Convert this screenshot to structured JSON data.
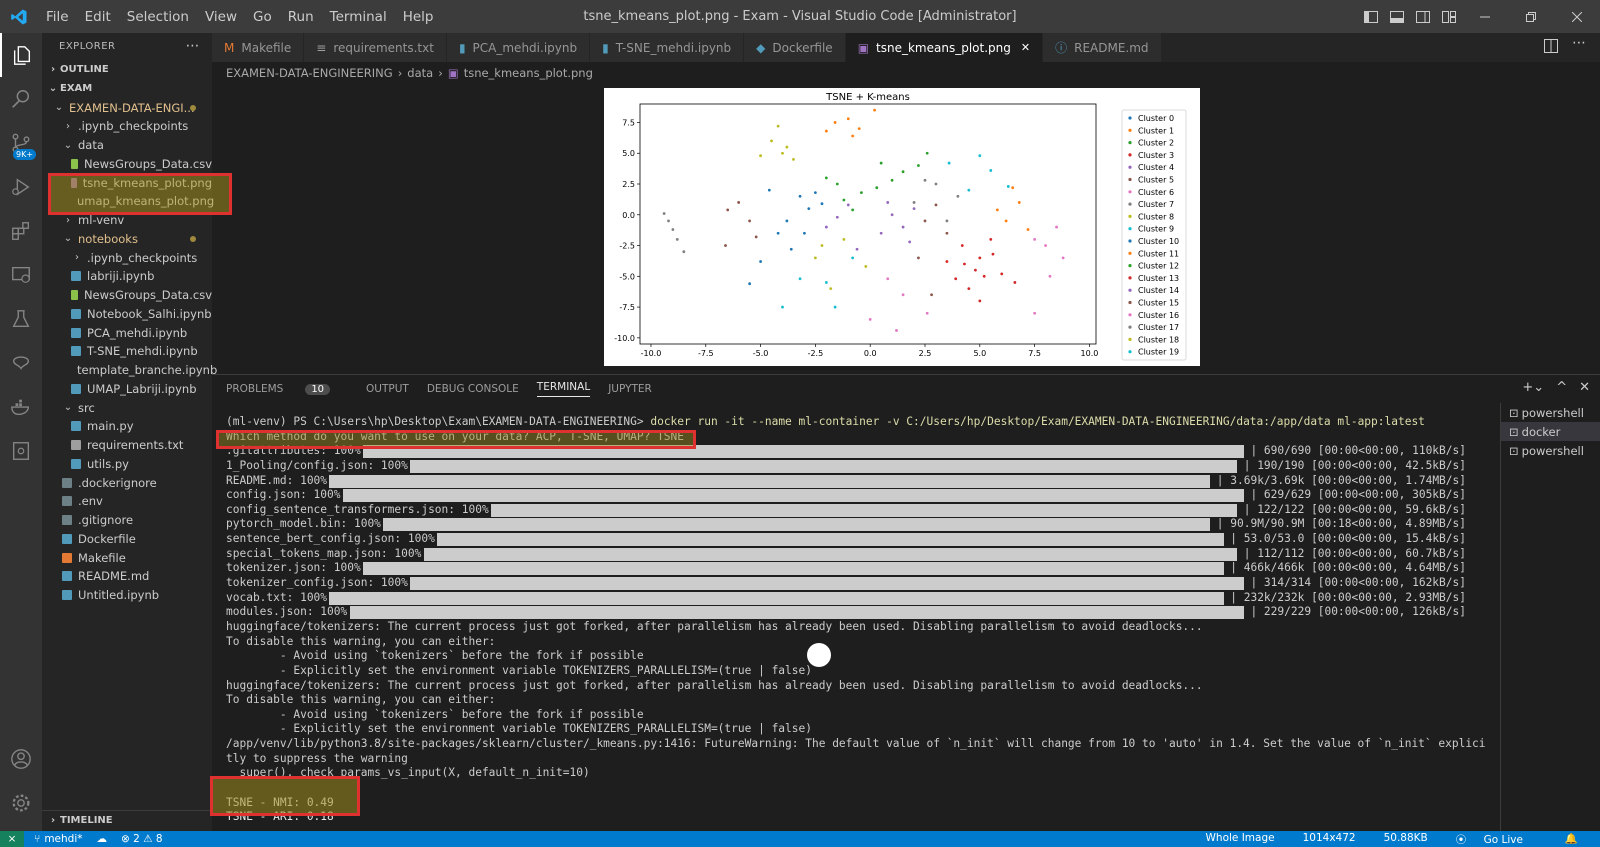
{
  "titlebar": {
    "menus": [
      "File",
      "Edit",
      "Selection",
      "View",
      "Go",
      "Run",
      "Terminal",
      "Help"
    ],
    "title": "tsne_kmeans_plot.png - Exam - Visual Studio Code [Administrator]"
  },
  "activity": {
    "scm_badge": "9K+"
  },
  "sidebar": {
    "header": "EXPLORER",
    "outline": "OUTLINE",
    "workspace": "EXAM",
    "timeline": "TIMELINE",
    "tree": [
      {
        "label": "EXAMEN-DATA-ENGI...",
        "indent": 1,
        "chev": "⌄",
        "color": "#e2c08d",
        "dot": true
      },
      {
        "label": ".ipynb_checkpoints",
        "indent": 2,
        "chev": "›"
      },
      {
        "label": "data",
        "indent": 2,
        "chev": "⌄"
      },
      {
        "label": "NewsGroups_Data.csv",
        "indent": 3,
        "icon": "#8bc34a"
      },
      {
        "label": "tsne_kmeans_plot.png",
        "indent": 3,
        "icon": "#a074c4",
        "color": "#e2e2e2"
      },
      {
        "label": "umap_kmeans_plot.png",
        "indent": 3,
        "icon": "#a074c4",
        "color": "#e2e2e2"
      },
      {
        "label": "ml-venv",
        "indent": 2,
        "chev": "›"
      },
      {
        "label": "notebooks",
        "indent": 2,
        "chev": "⌄",
        "color": "#e2c08d",
        "dot": true
      },
      {
        "label": ".ipynb_checkpoints",
        "indent": 3,
        "chev": "›"
      },
      {
        "label": "labriji.ipynb",
        "indent": 3,
        "icon": "#519aba"
      },
      {
        "label": "NewsGroups_Data.csv",
        "indent": 3,
        "icon": "#8bc34a"
      },
      {
        "label": "Notebook_Salhi.ipynb",
        "indent": 3,
        "icon": "#519aba"
      },
      {
        "label": "PCA_mehdi.ipynb",
        "indent": 3,
        "icon": "#519aba"
      },
      {
        "label": "T-SNE_mehdi.ipynb",
        "indent": 3,
        "icon": "#519aba"
      },
      {
        "label": "template_branche.ipynb",
        "indent": 3,
        "icon": "#519aba"
      },
      {
        "label": "UMAP_Labriji.ipynb",
        "indent": 3,
        "icon": "#519aba"
      },
      {
        "label": "src",
        "indent": 2,
        "chev": "⌄"
      },
      {
        "label": "main.py",
        "indent": 3,
        "icon": "#519aba"
      },
      {
        "label": "requirements.txt",
        "indent": 3,
        "icon": "#9e9e9e"
      },
      {
        "label": "utils.py",
        "indent": 3,
        "icon": "#519aba"
      },
      {
        "label": ".dockerignore",
        "indent": 2,
        "icon": "#6d8086"
      },
      {
        "label": ".env",
        "indent": 2,
        "icon": "#6d8086"
      },
      {
        "label": ".gitignore",
        "indent": 2,
        "icon": "#6d8086"
      },
      {
        "label": "Dockerfile",
        "indent": 2,
        "icon": "#519aba"
      },
      {
        "label": "Makefile",
        "indent": 2,
        "icon": "#e37933"
      },
      {
        "label": "README.md",
        "indent": 2,
        "icon": "#519aba"
      },
      {
        "label": "Untitled.ipynb",
        "indent": 2,
        "icon": "#519aba"
      }
    ]
  },
  "tabs": [
    {
      "label": "Makefile",
      "icon": "M",
      "color": "#e37933",
      "active": false
    },
    {
      "label": "requirements.txt",
      "icon": "≡",
      "color": "#9e9e9e",
      "active": false
    },
    {
      "label": "PCA_mehdi.ipynb",
      "icon": "▮",
      "color": "#519aba",
      "active": false
    },
    {
      "label": "T-SNE_mehdi.ipynb",
      "icon": "▮",
      "color": "#519aba",
      "active": false
    },
    {
      "label": "Dockerfile",
      "icon": "◆",
      "color": "#519aba",
      "active": false
    },
    {
      "label": "tsne_kmeans_plot.png",
      "icon": "▣",
      "color": "#a074c4",
      "active": true
    },
    {
      "label": "README.md",
      "icon": "ⓘ",
      "color": "#519aba",
      "active": false
    }
  ],
  "breadcrumb": [
    "EXAMEN-DATA-ENGINEERING",
    "data",
    "tsne_kmeans_plot.png"
  ],
  "chart_data": {
    "type": "scatter",
    "title": "TSNE + K-means",
    "xlim": [
      -10.5,
      10.3
    ],
    "ylim": [
      -10.5,
      9.0
    ],
    "xticks": [
      -10.0,
      -7.5,
      -5.0,
      -2.5,
      0.0,
      2.5,
      5.0,
      7.5,
      10.0
    ],
    "yticks": [
      -10.0,
      -7.5,
      -5.0,
      -2.5,
      0.0,
      2.5,
      5.0,
      7.5
    ],
    "legend_position": "right",
    "series": [
      {
        "name": "Cluster 0",
        "color": "#1f77b4",
        "points": [
          [
            -3.2,
            1.5
          ],
          [
            -2.8,
            0.5
          ],
          [
            -3.8,
            -0.5
          ],
          [
            -2.2,
            0.9
          ],
          [
            -3.0,
            -1.5
          ],
          [
            -2.5,
            1.8
          ]
        ]
      },
      {
        "name": "Cluster 1",
        "color": "#ff7f0e",
        "points": [
          [
            -1.6,
            7.5
          ],
          [
            -1.0,
            7.8
          ],
          [
            -0.5,
            7.0
          ],
          [
            -2.0,
            6.8
          ],
          [
            0.2,
            8.5
          ],
          [
            -0.8,
            6.4
          ]
        ]
      },
      {
        "name": "Cluster 2",
        "color": "#2ca02c",
        "points": [
          [
            -1.5,
            2.5
          ],
          [
            -1.2,
            1.2
          ],
          [
            -0.4,
            1.8
          ],
          [
            -2.0,
            3.0
          ],
          [
            -0.8,
            0.4
          ],
          [
            0.3,
            2.2
          ]
        ]
      },
      {
        "name": "Cluster 3",
        "color": "#d62728",
        "points": [
          [
            4.2,
            -2.5
          ],
          [
            5.0,
            -3.5
          ],
          [
            4.8,
            -4.5
          ],
          [
            3.9,
            -5.2
          ],
          [
            5.5,
            -2.0
          ],
          [
            4.5,
            -6.0
          ],
          [
            3.5,
            -3.8
          ]
        ]
      },
      {
        "name": "Cluster 4",
        "color": "#9467bd",
        "points": [
          [
            1.0,
            0.0
          ],
          [
            1.5,
            -1.0
          ],
          [
            2.0,
            0.5
          ],
          [
            0.8,
            1.0
          ],
          [
            1.8,
            -2.2
          ]
        ]
      },
      {
        "name": "Cluster 5",
        "color": "#8c564b",
        "points": [
          [
            -6.5,
            0.4
          ],
          [
            -5.5,
            -0.5
          ],
          [
            -6.0,
            1.0
          ],
          [
            -5.2,
            -1.8
          ],
          [
            -6.6,
            -2.5
          ]
        ]
      },
      {
        "name": "Cluster 6",
        "color": "#e377c2",
        "points": [
          [
            7.5,
            -2.0
          ],
          [
            8.0,
            -2.5
          ],
          [
            8.5,
            -1.0
          ],
          [
            8.8,
            -3.5
          ],
          [
            8.2,
            -5.0
          ],
          [
            7.5,
            -8.0
          ]
        ]
      },
      {
        "name": "Cluster 7",
        "color": "#7f7f7f",
        "points": [
          [
            -9.2,
            -0.5
          ],
          [
            -9.0,
            -1.2
          ],
          [
            -8.8,
            -2.0
          ],
          [
            -9.4,
            0.1
          ],
          [
            -8.5,
            -3.0
          ]
        ]
      },
      {
        "name": "Cluster 8",
        "color": "#bcbd22",
        "points": [
          [
            -4.0,
            5.0
          ],
          [
            -4.5,
            6.0
          ],
          [
            -3.5,
            4.5
          ],
          [
            -5.0,
            4.8
          ],
          [
            -4.2,
            7.2
          ],
          [
            -3.8,
            5.5
          ]
        ]
      },
      {
        "name": "Cluster 9",
        "color": "#17becf",
        "points": [
          [
            -3.2,
            -5.2
          ],
          [
            -2.0,
            -5.5
          ],
          [
            -1.6,
            -7.5
          ],
          [
            -4.0,
            -7.5
          ],
          [
            -0.8,
            -3.5
          ]
        ]
      },
      {
        "name": "Cluster 10",
        "color": "#1f77b4",
        "points": [
          [
            -4.2,
            -1.5
          ],
          [
            -5.0,
            -3.8
          ],
          [
            -4.6,
            2.0
          ],
          [
            -3.6,
            -2.8
          ],
          [
            -5.5,
            -5.6
          ]
        ]
      },
      {
        "name": "Cluster 11",
        "color": "#ff7f0e",
        "points": [
          [
            6.2,
            -0.5
          ],
          [
            6.8,
            1.0
          ],
          [
            5.8,
            0.4
          ],
          [
            7.2,
            -1.2
          ],
          [
            6.5,
            2.2
          ]
        ]
      },
      {
        "name": "Cluster 12",
        "color": "#2ca02c",
        "points": [
          [
            1.5,
            3.5
          ],
          [
            2.2,
            4.0
          ],
          [
            1.0,
            2.8
          ],
          [
            2.6,
            5.0
          ],
          [
            0.5,
            4.2
          ]
        ]
      },
      {
        "name": "Cluster 13",
        "color": "#d62728",
        "points": [
          [
            5.2,
            -5.0
          ],
          [
            6.0,
            -4.8
          ],
          [
            5.6,
            -3.2
          ],
          [
            6.6,
            -5.5
          ],
          [
            5.0,
            -7.0
          ],
          [
            4.3,
            -4.0
          ]
        ]
      },
      {
        "name": "Cluster 14",
        "color": "#9467bd",
        "points": [
          [
            -2.0,
            -1.0
          ],
          [
            -1.5,
            -0.2
          ],
          [
            -0.6,
            -2.8
          ],
          [
            -1.0,
            0.8
          ],
          [
            0.5,
            -1.5
          ]
        ]
      },
      {
        "name": "Cluster 15",
        "color": "#8c564b",
        "points": [
          [
            2.5,
            -0.5
          ],
          [
            3.0,
            0.8
          ],
          [
            2.2,
            -3.5
          ],
          [
            3.5,
            -1.5
          ],
          [
            2.8,
            -6.5
          ]
        ]
      },
      {
        "name": "Cluster 16",
        "color": "#e377c2",
        "points": [
          [
            0.0,
            -8.5
          ],
          [
            1.2,
            -9.4
          ],
          [
            1.5,
            -6.5
          ],
          [
            2.6,
            -8.0
          ],
          [
            0.8,
            -5.2
          ]
        ]
      },
      {
        "name": "Cluster 17",
        "color": "#7f7f7f",
        "points": [
          [
            2.0,
            1.0
          ],
          [
            3.0,
            2.5
          ],
          [
            4.0,
            1.5
          ],
          [
            3.5,
            -0.5
          ],
          [
            2.5,
            2.8
          ]
        ]
      },
      {
        "name": "Cluster 18",
        "color": "#bcbd22",
        "points": [
          [
            -2.5,
            -3.5
          ],
          [
            -1.2,
            -2.0
          ],
          [
            -2.2,
            -2.5
          ],
          [
            -0.2,
            -4.2
          ],
          [
            -1.8,
            -6.0
          ]
        ]
      },
      {
        "name": "Cluster 19",
        "color": "#17becf",
        "points": [
          [
            3.6,
            4.2
          ],
          [
            5.0,
            4.8
          ],
          [
            6.3,
            2.3
          ],
          [
            4.5,
            2.0
          ],
          [
            5.5,
            3.6
          ]
        ]
      }
    ]
  },
  "panel": {
    "tabs": [
      "PROBLEMS",
      "OUTPUT",
      "DEBUG CONSOLE",
      "TERMINAL",
      "JUPYTER"
    ],
    "problems_count": "10",
    "terminals": [
      "powershell",
      "docker",
      "powershell"
    ]
  },
  "terminal": {
    "prompt": "(ml-venv) PS C:\\Users\\hp\\Desktop\\Exam\\EXAMEN-DATA-ENGINEERING> ",
    "command": "docker run -it --name ml-container -v C:/Users/hp/Desktop/Exam/EXAMEN-DATA-ENGINEERING/data:/app/data ml-app:latest",
    "question": "Which method do you want to use on your data? ACP, T-SNE, UMAP? TSNE",
    "downloads": [
      {
        "name": ".gitattributes: 100%",
        "stats": "| 690/690 [00:00<00:00, 110kB/s]"
      },
      {
        "name": "1_Pooling/config.json: 100%",
        "stats": "| 190/190 [00:00<00:00, 42.5kB/s]"
      },
      {
        "name": "README.md: 100%",
        "stats": "| 3.69k/3.69k [00:00<00:00, 1.74MB/s]"
      },
      {
        "name": "config.json: 100%",
        "stats": "| 629/629 [00:00<00:00, 305kB/s]"
      },
      {
        "name": "config_sentence_transformers.json: 100%",
        "stats": "| 122/122 [00:00<00:00, 59.6kB/s]"
      },
      {
        "name": "pytorch_model.bin: 100%",
        "stats": "| 90.9M/90.9M [00:18<00:00, 4.89MB/s]"
      },
      {
        "name": "sentence_bert_config.json: 100%",
        "stats": "| 53.0/53.0 [00:00<00:00, 15.4kB/s]"
      },
      {
        "name": "special_tokens_map.json: 100%",
        "stats": "| 112/112 [00:00<00:00, 60.7kB/s]"
      },
      {
        "name": "tokenizer.json: 100%",
        "stats": "| 466k/466k [00:00<00:00, 4.64MB/s]"
      },
      {
        "name": "tokenizer_config.json: 100%",
        "stats": "| 314/314 [00:00<00:00, 162kB/s]"
      },
      {
        "name": "vocab.txt: 100%",
        "stats": "| 232k/232k [00:00<00:00, 2.93MB/s]"
      },
      {
        "name": "modules.json: 100%",
        "stats": "| 229/229 [00:00<00:00, 126kB/s]"
      }
    ],
    "log": [
      "huggingface/tokenizers: The current process just got forked, after parallelism has already been used. Disabling parallelism to avoid deadlocks...",
      "To disable this warning, you can either:",
      "        - Avoid using `tokenizers` before the fork if possible",
      "        - Explicitly set the environment variable TOKENIZERS_PARALLELISM=(true | false)",
      "huggingface/tokenizers: The current process just got forked, after parallelism has already been used. Disabling parallelism to avoid deadlocks...",
      "To disable this warning, you can either:",
      "        - Avoid using `tokenizers` before the fork if possible",
      "        - Explicitly set the environment variable TOKENIZERS_PARALLELISM=(true | false)",
      "/app/venv/lib/python3.8/site-packages/sklearn/cluster/_kmeans.py:1416: FutureWarning: The default value of `n_init` will change from 10 to 'auto' in 1.4. Set the value of `n_init` explici",
      "tly to suppress the warning",
      "  super()._check_params_vs_input(X, default_n_init=10)"
    ],
    "results": [
      "TSNE - NMI: 0.49",
      "TSNE - ARI: 0.18"
    ]
  },
  "status": {
    "branch": "mehdi*",
    "problems": "⊗ 2 ⚠ 8",
    "right": [
      "Whole Image",
      "1014x472",
      "50.88KB",
      "Go Live"
    ]
  }
}
